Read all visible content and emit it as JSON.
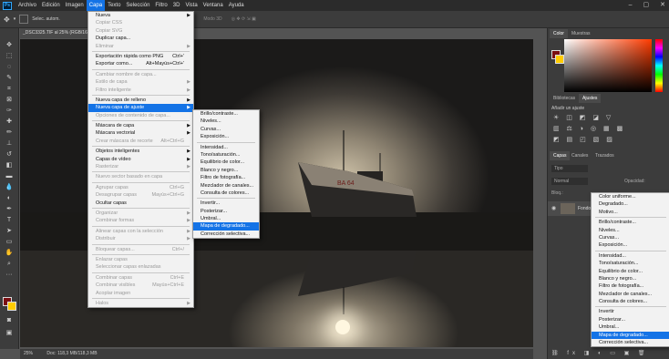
{
  "menubar": {
    "items": [
      "Archivo",
      "Edición",
      "Imagen",
      "Capa",
      "Texto",
      "Selección",
      "Filtro",
      "3D",
      "Vista",
      "Ventana",
      "Ayuda"
    ],
    "active": "Capa",
    "logo": "Ps"
  },
  "options_bar": {
    "select_label": "Selec. autom.",
    "mode3d": "Modo 3D"
  },
  "document": {
    "tab_title": "_DSC3325.TIF al 25% (RGB/16*)",
    "zoom": "25%",
    "doc_info": "Doc: 118,3 MB/118,3 MB",
    "boat_name": "BA 64"
  },
  "capa_menu": {
    "items": [
      {
        "label": "Nueva",
        "arrow": true
      },
      {
        "label": "Copiar CSS",
        "disabled": true
      },
      {
        "label": "Copiar SVG",
        "disabled": true
      },
      {
        "label": "Duplicar capa..."
      },
      {
        "label": "Eliminar",
        "arrow": true,
        "disabled": true
      },
      {
        "sep": true
      },
      {
        "label": "Exportación rápida como PNG",
        "shortcut": "Ctrl+'"
      },
      {
        "label": "Exportar como...",
        "shortcut": "Alt+Mayús+Ctrl+'"
      },
      {
        "sep": true
      },
      {
        "label": "Cambiar nombre de capa...",
        "disabled": true
      },
      {
        "label": "Estilo de capa",
        "arrow": true,
        "disabled": true
      },
      {
        "label": "Filtro inteligente",
        "arrow": true,
        "disabled": true
      },
      {
        "sep": true
      },
      {
        "label": "Nueva capa de relleno",
        "arrow": true
      },
      {
        "label": "Nueva capa de ajuste",
        "arrow": true,
        "highlight": true
      },
      {
        "label": "Opciones de contenido de capa...",
        "disabled": true
      },
      {
        "sep": true
      },
      {
        "label": "Máscara de capa",
        "arrow": true
      },
      {
        "label": "Máscara vectorial",
        "arrow": true
      },
      {
        "label": "Crear máscara de recorte",
        "shortcut": "Alt+Ctrl+G",
        "disabled": true
      },
      {
        "sep": true
      },
      {
        "label": "Objetos inteligentes",
        "arrow": true
      },
      {
        "label": "Capas de vídeo",
        "arrow": true
      },
      {
        "label": "Rasterizar",
        "arrow": true,
        "disabled": true
      },
      {
        "sep": true
      },
      {
        "label": "Nuevo sector basado en capa",
        "disabled": true
      },
      {
        "sep": true
      },
      {
        "label": "Agrupar capas",
        "shortcut": "Ctrl+G",
        "disabled": true
      },
      {
        "label": "Desagrupar capas",
        "shortcut": "Mayús+Ctrl+G",
        "disabled": true
      },
      {
        "label": "Ocultar capas"
      },
      {
        "sep": true
      },
      {
        "label": "Organizar",
        "arrow": true,
        "disabled": true
      },
      {
        "label": "Combinar formas",
        "arrow": true,
        "disabled": true
      },
      {
        "sep": true
      },
      {
        "label": "Alinear capas con la selección",
        "arrow": true,
        "disabled": true
      },
      {
        "label": "Distribuir",
        "arrow": true,
        "disabled": true
      },
      {
        "sep": true
      },
      {
        "label": "Bloquear capas...",
        "shortcut": "Ctrl+/",
        "disabled": true
      },
      {
        "sep": true
      },
      {
        "label": "Enlazar capas",
        "disabled": true
      },
      {
        "label": "Seleccionar capas enlazadas",
        "disabled": true
      },
      {
        "sep": true
      },
      {
        "label": "Combinar capas",
        "shortcut": "Ctrl+E",
        "disabled": true
      },
      {
        "label": "Combinar visibles",
        "shortcut": "Mayús+Ctrl+E",
        "disabled": true
      },
      {
        "label": "Acoplar imagen",
        "disabled": true
      },
      {
        "sep": true
      },
      {
        "label": "Halos",
        "arrow": true,
        "disabled": true
      }
    ]
  },
  "ajuste_submenu": {
    "items": [
      {
        "label": "Brillo/contraste..."
      },
      {
        "label": "Niveles..."
      },
      {
        "label": "Curvas..."
      },
      {
        "label": "Exposición..."
      },
      {
        "sep": true
      },
      {
        "label": "Intensidad..."
      },
      {
        "label": "Tono/saturación..."
      },
      {
        "label": "Equilibrio de color..."
      },
      {
        "label": "Blanco y negro..."
      },
      {
        "label": "Filtro de fotografía..."
      },
      {
        "label": "Mezclador de canales..."
      },
      {
        "label": "Consulta de colores..."
      },
      {
        "sep": true
      },
      {
        "label": "Invertir..."
      },
      {
        "label": "Posterizar..."
      },
      {
        "label": "Umbral..."
      },
      {
        "label": "Mapa de degradado...",
        "highlight": true
      },
      {
        "label": "Corrección selectiva..."
      }
    ]
  },
  "panels": {
    "color_tabs": [
      "Color",
      "Muestras"
    ],
    "adjust_tabs": [
      "Bibliotecas",
      "Ajustes"
    ],
    "adjust_hint": "Añadir un ajuste",
    "layer_tabs": [
      "Capas",
      "Canales",
      "Trazados"
    ],
    "kind_label": "Tipo",
    "blend_mode": "Normal",
    "opacity_label": "Opacidad:",
    "lock_label": "Bloq.:",
    "layer_name": "Fondo",
    "fg_color": "#7a0f12",
    "bg_color": "#ffcc00"
  },
  "layers_popup": {
    "items": [
      {
        "label": "Color uniforme..."
      },
      {
        "label": "Degradado..."
      },
      {
        "label": "Motivo..."
      },
      {
        "sep": true
      },
      {
        "label": "Brillo/contraste..."
      },
      {
        "label": "Niveles..."
      },
      {
        "label": "Curvas..."
      },
      {
        "label": "Exposición..."
      },
      {
        "sep": true
      },
      {
        "label": "Intensidad..."
      },
      {
        "label": "Tono/saturación..."
      },
      {
        "label": "Equilibrio de color..."
      },
      {
        "label": "Blanco y negro..."
      },
      {
        "label": "Filtro de fotografía..."
      },
      {
        "label": "Mezclador de canales..."
      },
      {
        "label": "Consulta de colores..."
      },
      {
        "sep": true
      },
      {
        "label": "Invertir"
      },
      {
        "label": "Posterizar..."
      },
      {
        "label": "Umbral..."
      },
      {
        "label": "Mapa de degradado...",
        "highlight": true
      },
      {
        "label": "Corrección selectiva..."
      }
    ]
  }
}
